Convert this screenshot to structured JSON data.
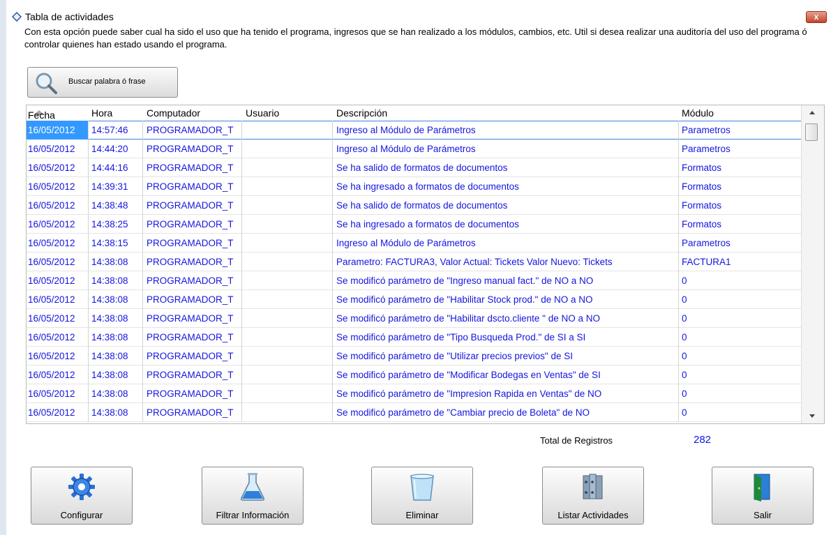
{
  "window": {
    "title": "Tabla de actividades",
    "close_label": "x"
  },
  "description": "Con esta opción puede saber cual ha sido el uso que ha tenido el programa, ingresos que se han realizado a los módulos, cambios, etc. Util si desea realizar una auditoría del uso del programa ó controlar quienes han estado usando el programa.",
  "search_button": {
    "label": "Buscar palabra ó frase",
    "icon": "search-icon"
  },
  "table": {
    "columns": [
      "Fecha",
      "Hora",
      "Computador",
      "Usuario",
      "Descripción",
      "Módulo"
    ],
    "sorted_column": "Fecha",
    "rows": [
      [
        "16/05/2012",
        "14:57:46",
        "PROGRAMADOR_T",
        "",
        "Ingreso al Módulo de Parámetros",
        "Parametros"
      ],
      [
        "16/05/2012",
        "14:44:20",
        "PROGRAMADOR_T",
        "",
        "Ingreso al Módulo de Parámetros",
        "Parametros"
      ],
      [
        "16/05/2012",
        "14:44:16",
        "PROGRAMADOR_T",
        "",
        "Se ha salido de formatos de documentos",
        "Formatos"
      ],
      [
        "16/05/2012",
        "14:39:31",
        "PROGRAMADOR_T",
        "",
        "Se ha ingresado a formatos de documentos",
        "Formatos"
      ],
      [
        "16/05/2012",
        "14:38:48",
        "PROGRAMADOR_T",
        "",
        "Se ha salido de formatos de documentos",
        "Formatos"
      ],
      [
        "16/05/2012",
        "14:38:25",
        "PROGRAMADOR_T",
        "",
        "Se ha ingresado a formatos de documentos",
        "Formatos"
      ],
      [
        "16/05/2012",
        "14:38:15",
        "PROGRAMADOR_T",
        "",
        "Ingreso al Módulo de Parámetros",
        "Parametros"
      ],
      [
        "16/05/2012",
        "14:38:08",
        "PROGRAMADOR_T",
        "",
        "Parametro: FACTURA3, Valor Actual: Tickets Valor Nuevo: Tickets",
        "FACTURA1"
      ],
      [
        "16/05/2012",
        "14:38:08",
        "PROGRAMADOR_T",
        "",
        "Se modificó parámetro de \"Ingreso manual fact.\" de NO a NO",
        "0"
      ],
      [
        "16/05/2012",
        "14:38:08",
        "PROGRAMADOR_T",
        "",
        "Se modificó parámetro de \"Habilitar Stock prod.\" de NO a NO",
        "0"
      ],
      [
        "16/05/2012",
        "14:38:08",
        "PROGRAMADOR_T",
        "",
        "Se modificó parámetro de \"Habilitar dscto.cliente \" de NO a NO",
        "0"
      ],
      [
        "16/05/2012",
        "14:38:08",
        "PROGRAMADOR_T",
        "",
        "Se modificó parámetro de \"Tipo Busqueda Prod.\" de SI a SI",
        "0"
      ],
      [
        "16/05/2012",
        "14:38:08",
        "PROGRAMADOR_T",
        "",
        "Se modificó parámetro de \"Utilizar precios previos\" de SI",
        "0"
      ],
      [
        "16/05/2012",
        "14:38:08",
        "PROGRAMADOR_T",
        "",
        "Se modificó parámetro de \"Modificar Bodegas en Ventas\" de SI",
        "0"
      ],
      [
        "16/05/2012",
        "14:38:08",
        "PROGRAMADOR_T",
        "",
        "Se modificó parámetro de \"Impresion Rapida en Ventas\" de NO",
        "0"
      ],
      [
        "16/05/2012",
        "14:38:08",
        "PROGRAMADOR_T",
        "",
        "Se modificó parámetro de \"Cambiar precio de Boleta\" de NO",
        "0"
      ]
    ]
  },
  "totals": {
    "label": "Total de Registros",
    "value": "282"
  },
  "buttons": [
    {
      "name": "configurar-button",
      "label": "Configurar",
      "icon": "gear-icon"
    },
    {
      "name": "filtrar-informacion-button",
      "label": "Filtrar Información",
      "icon": "flask-icon"
    },
    {
      "name": "eliminar-button",
      "label": "Eliminar",
      "icon": "trash-bin-icon"
    },
    {
      "name": "listar-actividades-button",
      "label": "Listar Actividades",
      "icon": "binders-icon"
    },
    {
      "name": "salir-button",
      "label": "Salir",
      "icon": "exit-door-icon"
    }
  ],
  "colors": {
    "link_text": "#1515e0",
    "selection": "#3399ff",
    "close_button": "#c3462c"
  }
}
